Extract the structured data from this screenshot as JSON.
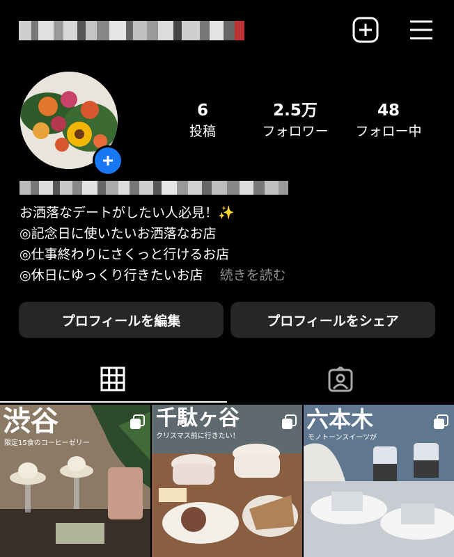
{
  "header": {
    "add_icon": "plus-square-icon",
    "menu_icon": "hamburger-menu-icon"
  },
  "profile": {
    "stats": [
      {
        "value": "6",
        "label": "投稿"
      },
      {
        "value": "2.5万",
        "label": "フォロワー"
      },
      {
        "value": "48",
        "label": "フォロー中"
      }
    ],
    "bio_lines": [
      "お洒落なデートがしたい人必見！✨",
      "◎記念日に使いたいお洒落なお店",
      "◎仕事終わりにさくっと行けるお店",
      "◎休日にゆっくり行きたいお店"
    ],
    "more_label": "続きを読む"
  },
  "actions": {
    "edit_label": "プロフィールを編集",
    "share_label": "プロフィールをシェア"
  },
  "tabs": {
    "grid_icon": "grid-icon",
    "tagged_icon": "tagged-person-icon"
  },
  "posts": [
    {
      "title": "渋谷",
      "subtitle": "限定15食のコーヒーゼリー"
    },
    {
      "title": "千駄ヶ谷",
      "subtitle": "クリスマス前に行きたい！"
    },
    {
      "title": "六本木",
      "subtitle": "モノトーンスイーツが"
    }
  ],
  "colors": {
    "accent": "#1877f2",
    "button_bg": "#262626",
    "muted": "#8e8e8e"
  }
}
